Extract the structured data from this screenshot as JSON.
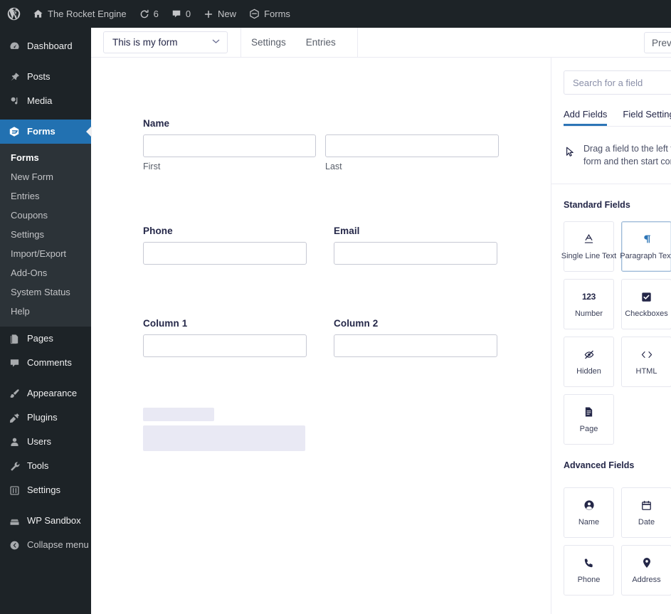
{
  "adminbar": {
    "logo_icon": "wordpress-icon",
    "site_icon": "home-icon",
    "site_name": "The Rocket Engine",
    "updates_icon": "updates-icon",
    "updates_count": "6",
    "comments_icon": "comment-icon",
    "comments_count": "0",
    "new_icon": "plus-icon",
    "new_label": "New",
    "forms_icon": "gravityforms-icon",
    "forms_label": "Forms"
  },
  "sidebar": {
    "items": [
      {
        "label": "Dashboard",
        "icon": "dashboard-icon"
      },
      {
        "label": "Posts",
        "icon": "pin-icon"
      },
      {
        "label": "Media",
        "icon": "media-icon"
      },
      {
        "label": "Forms",
        "icon": "gravityforms-icon",
        "active": true
      },
      {
        "label": "Pages",
        "icon": "pages-icon"
      },
      {
        "label": "Comments",
        "icon": "comment-icon"
      },
      {
        "label": "Appearance",
        "icon": "brush-icon"
      },
      {
        "label": "Plugins",
        "icon": "plug-icon"
      },
      {
        "label": "Users",
        "icon": "user-icon"
      },
      {
        "label": "Tools",
        "icon": "wrench-icon"
      },
      {
        "label": "Settings",
        "icon": "settings-icon"
      },
      {
        "label": "WP Sandbox",
        "icon": "sandbox-icon"
      },
      {
        "label": "Collapse menu",
        "icon": "collapse-icon"
      }
    ],
    "submenu": [
      {
        "label": "Forms",
        "current": true
      },
      {
        "label": "New Form"
      },
      {
        "label": "Entries"
      },
      {
        "label": "Coupons"
      },
      {
        "label": "Settings"
      },
      {
        "label": "Import/Export"
      },
      {
        "label": "Add-Ons"
      },
      {
        "label": "System Status"
      },
      {
        "label": "Help"
      }
    ]
  },
  "toolbar": {
    "form_selected": "This is my form",
    "chevron_icon": "chevron-down-icon",
    "settings_label": "Settings",
    "entries_label": "Entries",
    "preview_label": "Preview"
  },
  "form": {
    "fields": [
      {
        "label": "Name",
        "sub_left": "First",
        "sub_right": "Last",
        "type": "name"
      },
      {
        "label": "Phone",
        "type": "text"
      },
      {
        "label": "Email",
        "type": "text"
      },
      {
        "label": "Column 1",
        "type": "text"
      },
      {
        "label": "Column 2",
        "type": "text"
      }
    ]
  },
  "panel": {
    "search_placeholder": "Search for a field",
    "tabs": [
      {
        "label": "Add Fields",
        "active": true
      },
      {
        "label": "Field Settings",
        "active": false
      }
    ],
    "hint_icon": "cursor-icon",
    "hint_text": "Drag a field to the left to st\nform and then start configu",
    "standard_title": "Standard Fields",
    "standard_fields": [
      {
        "label": "Single Line Text",
        "icon": "text-a-icon"
      },
      {
        "label": "Paragraph Text",
        "icon": "pilcrow-icon",
        "highlighted": true
      },
      {
        "label": "Number",
        "icon": "number-123-icon"
      },
      {
        "label": "Checkboxes",
        "icon": "checkbox-icon"
      },
      {
        "label": "Hidden",
        "icon": "eye-slash-icon"
      },
      {
        "label": "HTML",
        "icon": "code-icon"
      },
      {
        "label": "Page",
        "icon": "document-icon"
      }
    ],
    "advanced_title": "Advanced Fields",
    "advanced_fields": [
      {
        "label": "Name",
        "icon": "person-icon"
      },
      {
        "label": "Date",
        "icon": "calendar-icon"
      },
      {
        "label": "Phone",
        "icon": "phone-icon"
      },
      {
        "label": "Address",
        "icon": "map-pin-icon"
      }
    ]
  },
  "colors": {
    "admin_dark": "#1d2327",
    "submenu_dark": "#2c3338",
    "wp_blue": "#2271b1",
    "accent_blue": "#2d75b6",
    "text_dark": "#242748",
    "placeholder_lavender": "#e9e9f4"
  }
}
